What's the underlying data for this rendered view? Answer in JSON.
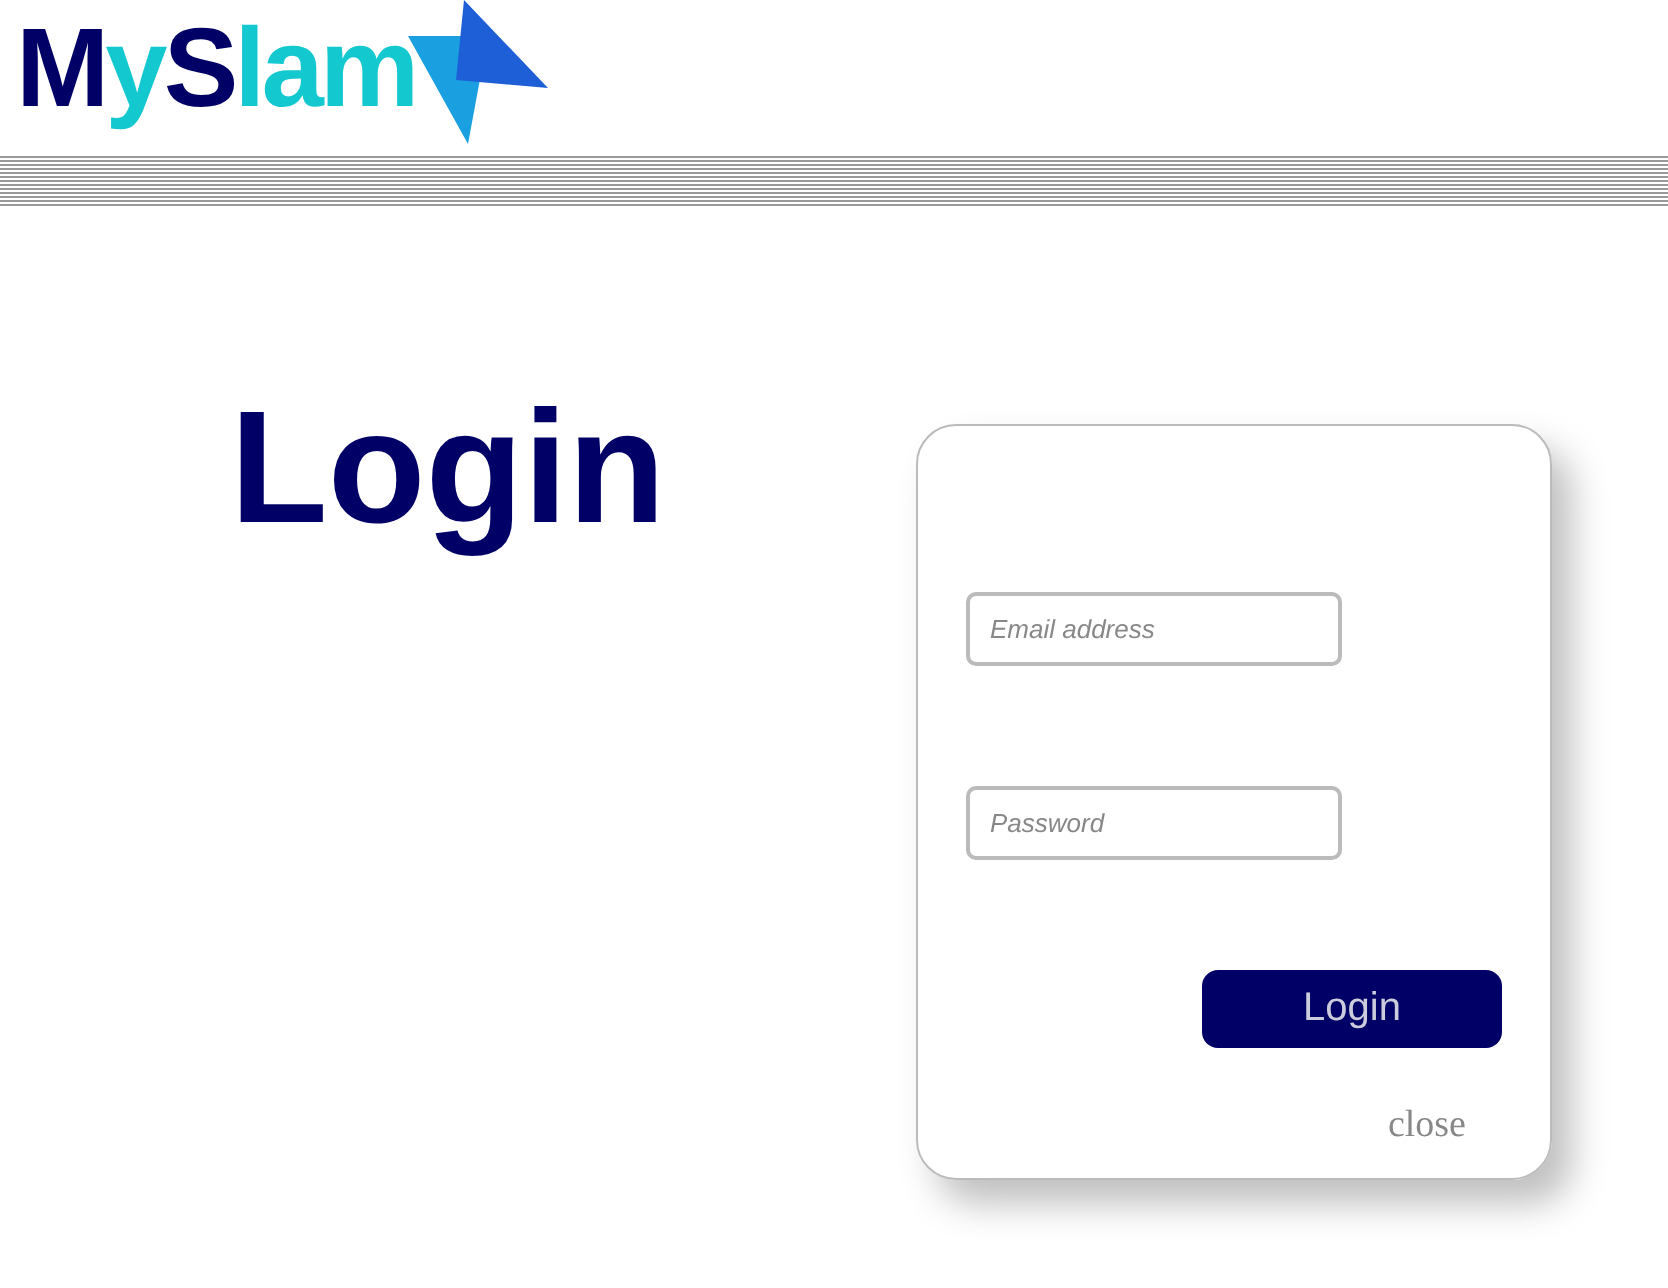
{
  "logo": {
    "parts": [
      {
        "text": "M",
        "color": "#000066"
      },
      {
        "text": "y",
        "color": "#14c8d0"
      },
      {
        "text": "S",
        "color": "#000066"
      },
      {
        "text": "lam",
        "color": "#14c8d0"
      }
    ]
  },
  "heading": "Login",
  "form": {
    "email": {
      "placeholder": "Email address"
    },
    "password": {
      "placeholder": "Password"
    },
    "submit": "Login",
    "close": "close"
  }
}
